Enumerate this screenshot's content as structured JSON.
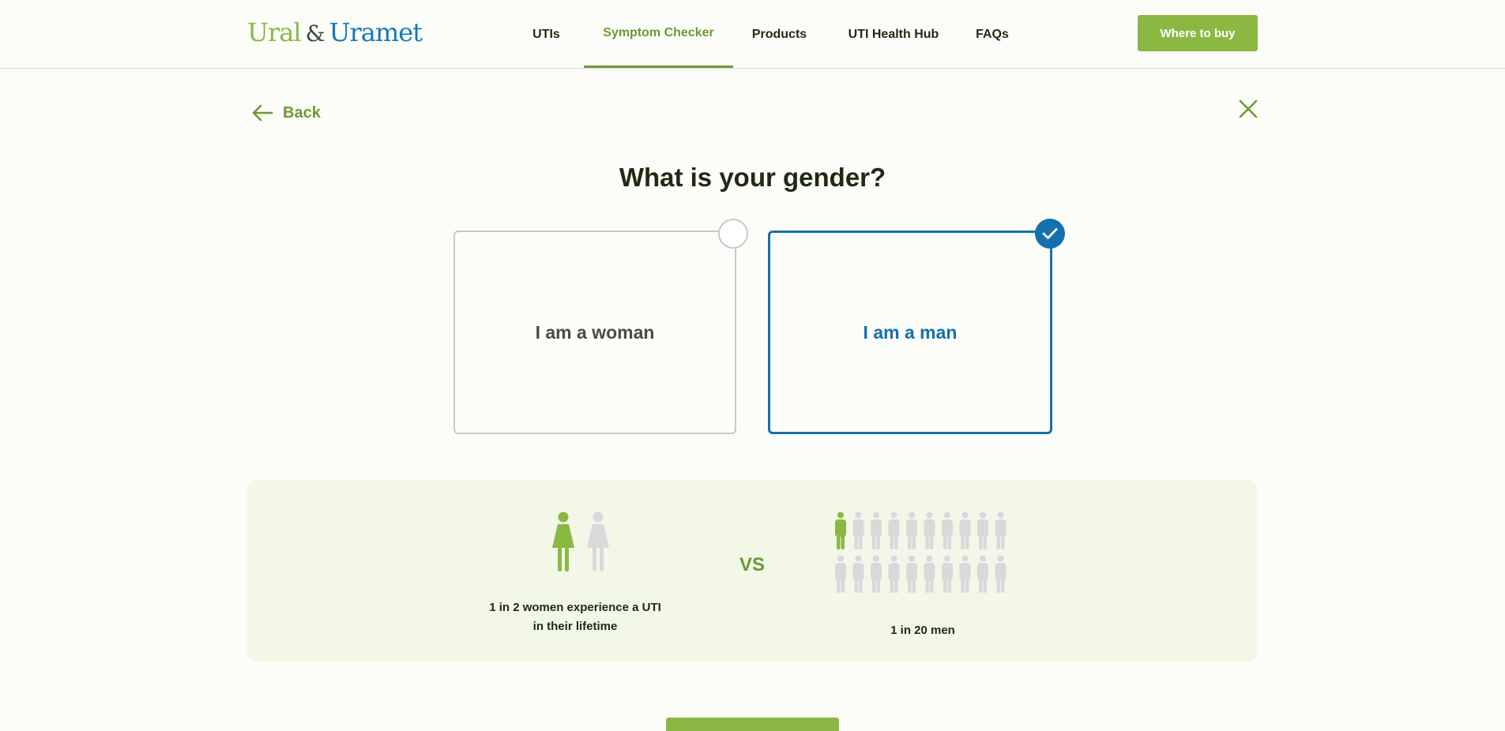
{
  "header": {
    "logo": {
      "part1": "Ural",
      "amp": "&",
      "part2": "Uramet"
    },
    "nav": [
      {
        "label": "UTIs"
      },
      {
        "label": "Symptom Checker"
      },
      {
        "label": "Products"
      },
      {
        "label": "UTI Health Hub"
      },
      {
        "label": "FAQs"
      }
    ],
    "cta_label": "Where to buy"
  },
  "back_label": "Back",
  "question": "What is your gender?",
  "options": [
    {
      "label": "I am a woman",
      "selected": false
    },
    {
      "label": "I am a man",
      "selected": true
    }
  ],
  "stats": {
    "women_text_line1": "1 in 2 women experience a UTI",
    "women_text_line2": "in their lifetime",
    "vs_label": "VS",
    "men_text": "1 in 20 men",
    "women_highlighted": 1,
    "women_total": 2,
    "men_highlighted": 1,
    "men_total": 20
  },
  "colors": {
    "brand_green": "#8ab843",
    "accent_green": "#6a9a34",
    "brand_blue": "#1471ad",
    "inactive_figure": "#d9d9d9"
  },
  "icons": [
    "arrow-left-icon",
    "close-icon",
    "check-icon",
    "woman-figure-icon",
    "man-figure-icon"
  ]
}
